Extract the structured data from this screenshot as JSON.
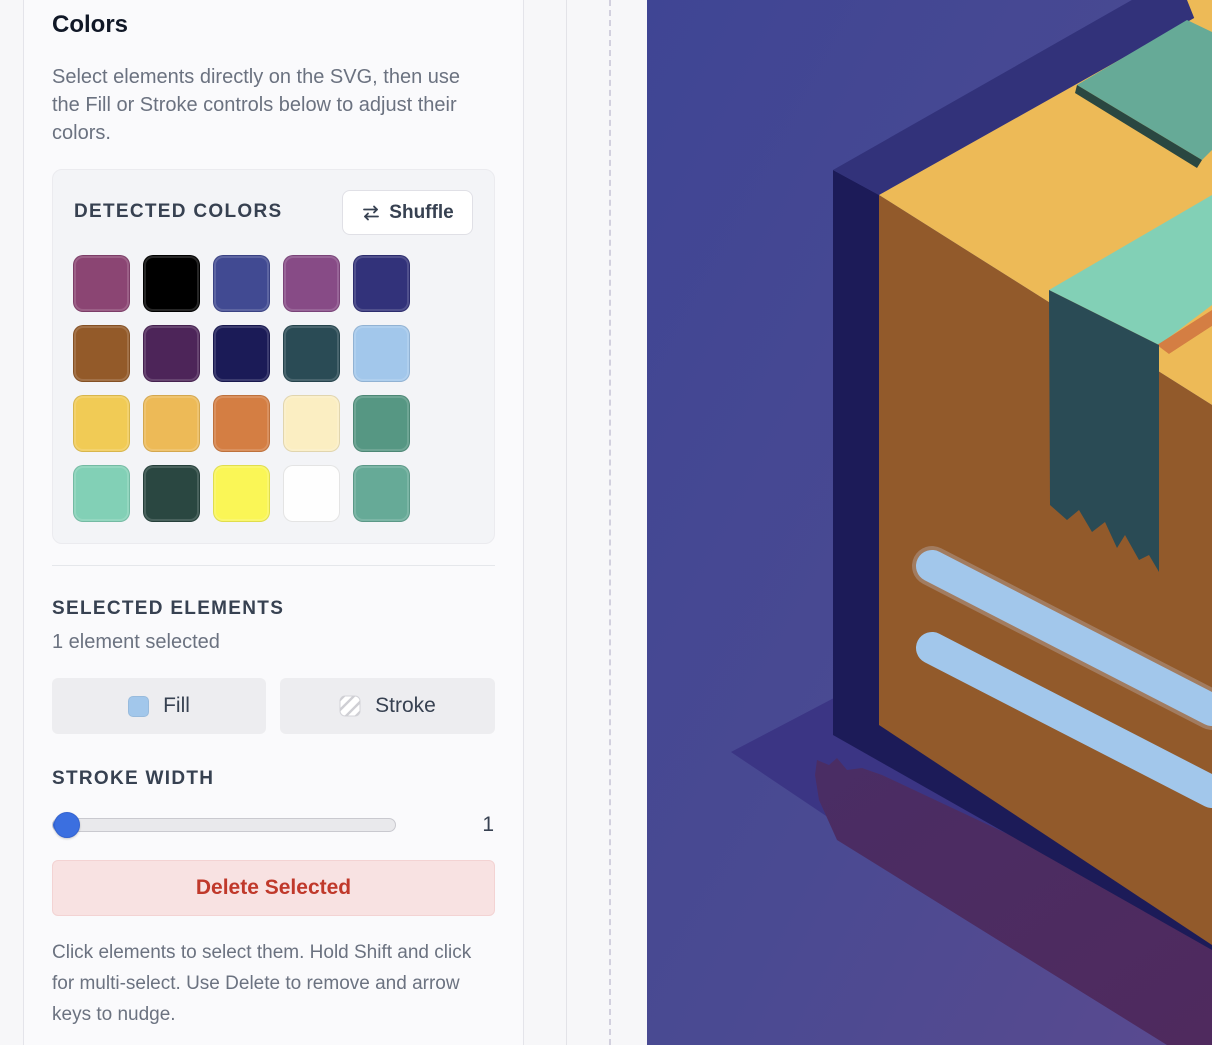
{
  "panel": {
    "title": "Colors",
    "description": "Select elements directly on the SVG, then use the Fill or Stroke controls below to adjust their colors."
  },
  "detected_colors": {
    "heading": "DETECTED COLORS",
    "shuffle_label": "Shuffle",
    "shuffle_icon": "shuffle-icon",
    "swatches": [
      "#8b4573",
      "#000000",
      "#414a92",
      "#874b86",
      "#32327a",
      "#935a29",
      "#4d2559",
      "#1b1b57",
      "#2a4b55",
      "#a2c7eb",
      "#f1cb55",
      "#edba57",
      "#d47e43",
      "#fbeec2",
      "#569783",
      "#82d0b6",
      "#2a4741",
      "#faf656",
      "#fefefe",
      "#66aa97"
    ]
  },
  "selected_elements": {
    "heading": "SELECTED ELEMENTS",
    "count_text": "1 element selected",
    "fill_label": "Fill",
    "fill_color": "#a2c7eb",
    "stroke_label": "Stroke",
    "stroke_icon": "no-stroke-icon"
  },
  "stroke_width": {
    "heading": "STROKE WIDTH",
    "value": 1,
    "min": 1,
    "max": 20,
    "display": "1"
  },
  "delete_button_label": "Delete Selected",
  "help_text": "Click elements to select them. Hold Shift and click for multi-select. Use Delete to remove and arrow keys to nudge.",
  "colors": {
    "accent": "#3b6fe0",
    "danger": "#c0392b",
    "danger_bg": "#f8e2e2"
  }
}
